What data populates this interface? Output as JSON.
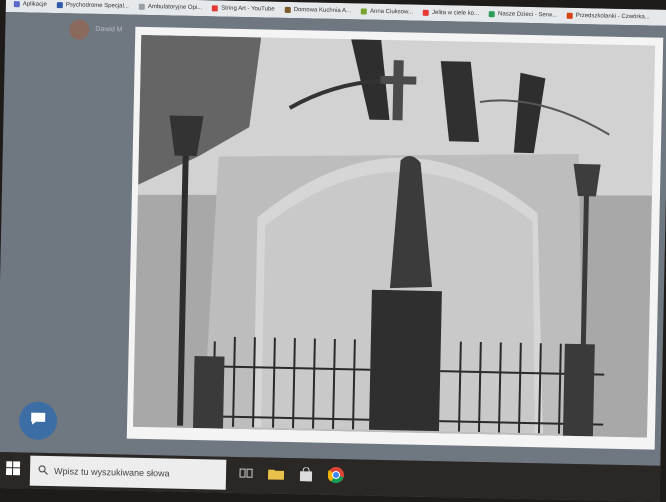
{
  "bookmarks": [
    {
      "label": "Aplikacje",
      "color": "#5a6ac9"
    },
    {
      "label": "Psychodrome Specjal...",
      "color": "#2f5aa8"
    },
    {
      "label": "Ambulatoryjne Opi...",
      "color": "#9aa0a6"
    },
    {
      "label": "String Art - YouTube",
      "color": "#e53935"
    },
    {
      "label": "Domowa Kuchnia A...",
      "color": "#7c5a2a"
    },
    {
      "label": "Anna Ciuksow...",
      "color": "#78a62d"
    },
    {
      "label": "Jelita w ciele ko...",
      "color": "#e53935"
    },
    {
      "label": "Nasze Dzieci - Serw...",
      "color": "#2e9b57"
    },
    {
      "label": "Przedszkolanki - Czwórka...",
      "color": "#d84315"
    }
  ],
  "username": "Dawid M",
  "taskbar": {
    "search_placeholder": "Wpisz tu wyszukiwane słowa"
  },
  "icons": [
    "windows-icon",
    "search-icon",
    "task-view-icon",
    "file-explorer-icon",
    "store-icon",
    "chrome-icon",
    "chat-icon"
  ]
}
